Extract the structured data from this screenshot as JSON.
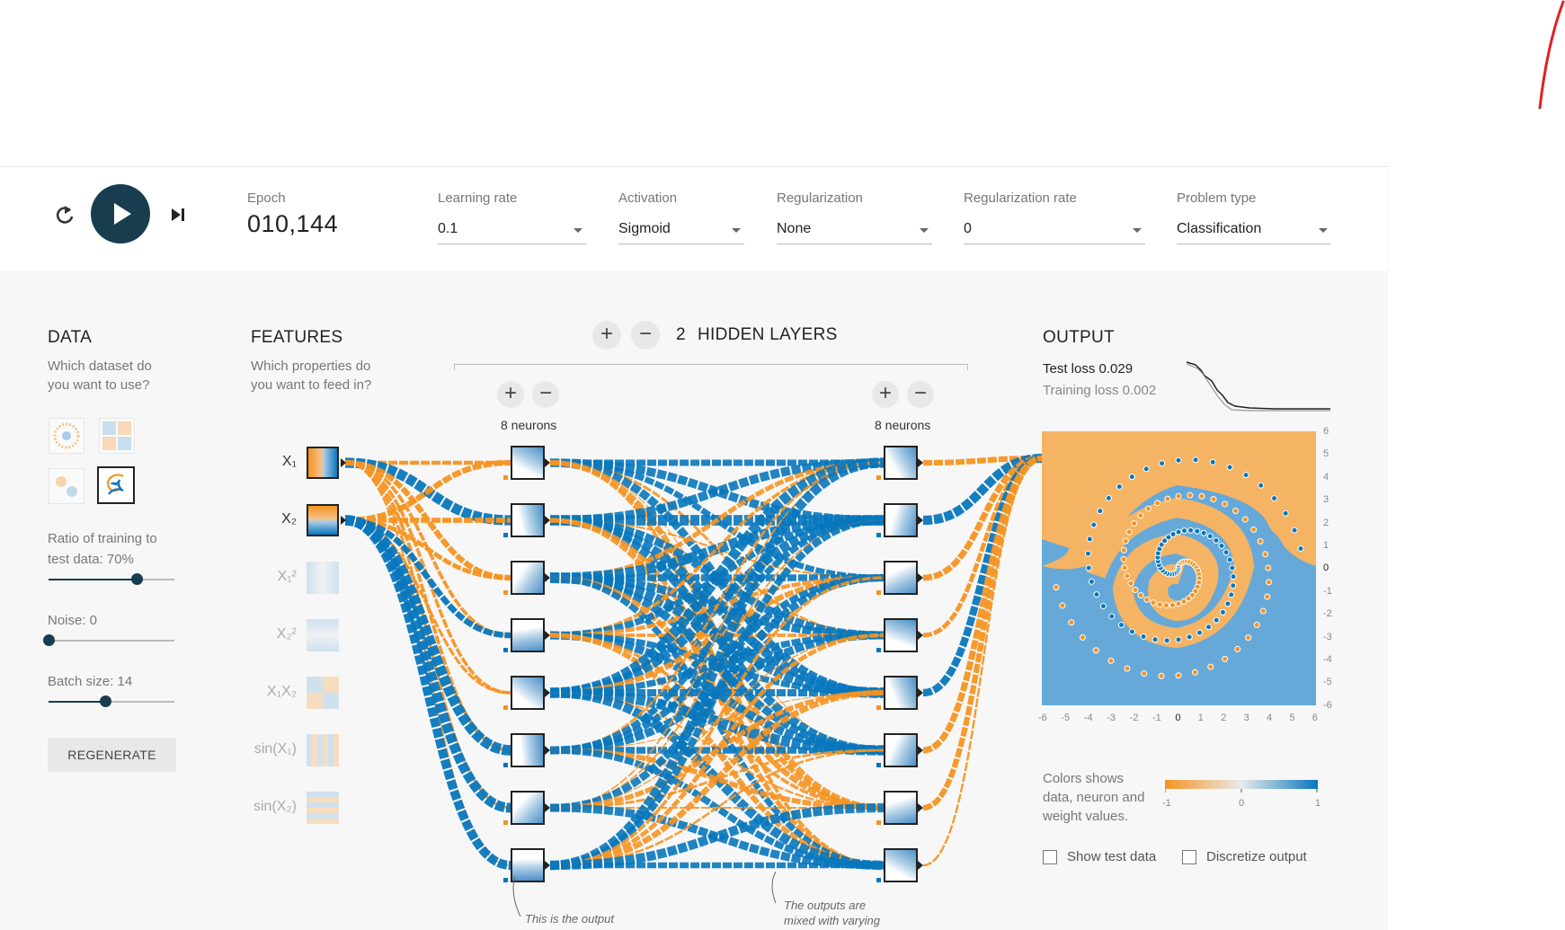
{
  "controls": {
    "reset_icon": "reset-icon",
    "play_icon": "play-icon",
    "step_icon": "step-icon"
  },
  "epoch": {
    "label": "Epoch",
    "value": "010,144"
  },
  "learning_rate": {
    "label": "Learning rate",
    "value": "0.1"
  },
  "activation": {
    "label": "Activation",
    "value": "Sigmoid"
  },
  "regularization": {
    "label": "Regularization",
    "value": "None"
  },
  "regularization_rate": {
    "label": "Regularization rate",
    "value": "0"
  },
  "problem_type": {
    "label": "Problem type",
    "value": "Classification"
  },
  "data": {
    "title": "DATA",
    "desc_line1": "Which dataset do",
    "desc_line2": "you want to use?",
    "ratio_line1": "Ratio of training to",
    "ratio_line2": "test data:  70%",
    "ratio_value": 0.7,
    "noise_label": "Noise:  0",
    "noise_value": 0,
    "batch_label": "Batch size:  14",
    "batch_value": 0.45,
    "regenerate": "REGENERATE"
  },
  "features": {
    "title": "FEATURES",
    "desc_line1": "Which properties do",
    "desc_line2": "you want to feed in?",
    "items": [
      {
        "label": "X₁",
        "active": true
      },
      {
        "label": "X₂",
        "active": true
      },
      {
        "label": "X₁²",
        "active": false
      },
      {
        "label": "X₂²",
        "active": false
      },
      {
        "label": "X₁X₂",
        "active": false
      },
      {
        "label": "sin(X₁)",
        "active": false
      },
      {
        "label": "sin(X₂)",
        "active": false
      }
    ]
  },
  "hidden": {
    "count": "2",
    "label": "HIDDEN LAYERS",
    "plus": "+",
    "minus": "−",
    "layer1_neurons": "8 neurons",
    "layer2_neurons": "8 neurons"
  },
  "output": {
    "title": "OUTPUT",
    "test_loss": "Test loss 0.029",
    "training_loss": "Training loss 0.002",
    "y_ticks": [
      "6",
      "5",
      "4",
      "3",
      "2",
      "1",
      "0",
      "-1",
      "-2",
      "-3",
      "-4",
      "-5",
      "-6"
    ],
    "x_ticks": [
      "-6",
      "-5",
      "-4",
      "-3",
      "-2",
      "-1",
      "0",
      "1",
      "2",
      "3",
      "4",
      "5",
      "6"
    ],
    "legend_line1": "Colors shows",
    "legend_line2": "data, neuron and",
    "legend_line3": "weight values.",
    "legend_min": "-1",
    "legend_mid": "0",
    "legend_max": "1",
    "show_test": "Show test data",
    "discretize": "Discretize output"
  },
  "notes": {
    "note1": "This is the output",
    "note2_line1": "The outputs are",
    "note2_line2": "mixed with varying"
  },
  "colors": {
    "orange": "#f59322",
    "blue": "#0877bd",
    "dark": "#183d4e"
  }
}
